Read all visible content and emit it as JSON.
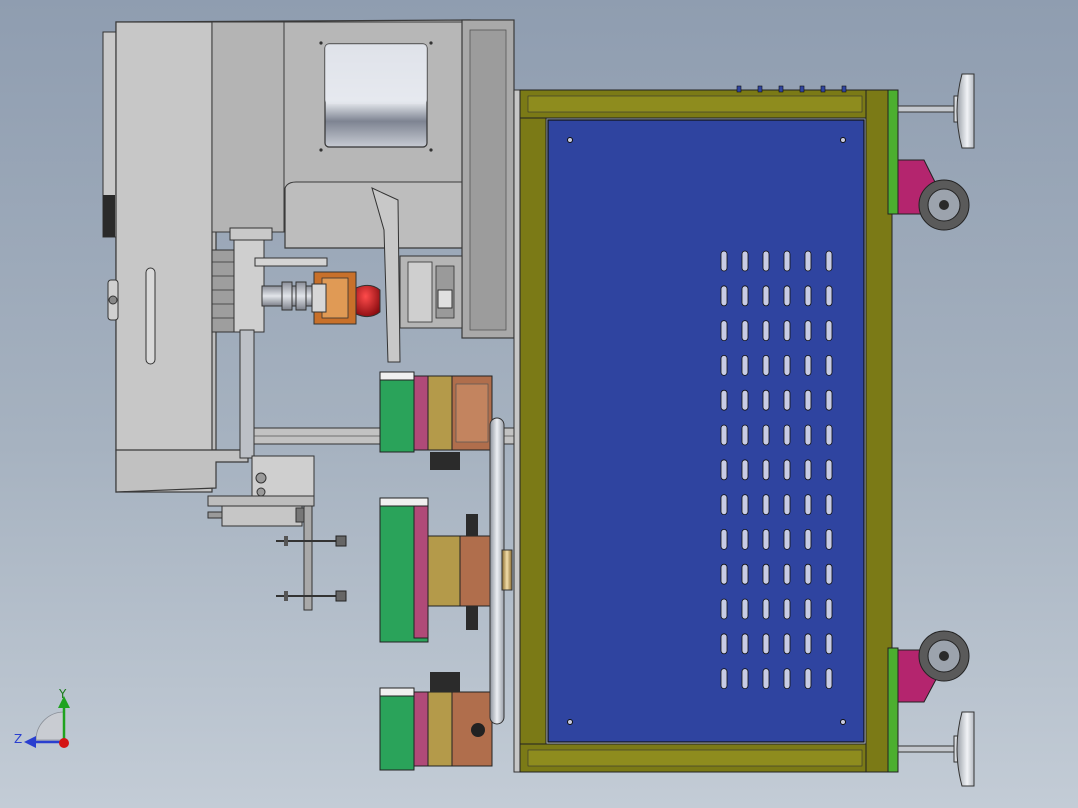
{
  "viewport": {
    "background_top": "#8f9db0",
    "background_bottom": "#c3ccd6"
  },
  "triad": {
    "y_label": "Y",
    "z_label": "Z",
    "y_color": "#1fa31f",
    "z_color": "#2a3fcf",
    "x_color": "#d41414"
  },
  "colors": {
    "machine_gray": "#b9b9b9",
    "frame_olive": "#7b7a16",
    "frame_green": "#4caf2f",
    "panel_blue": "#2f44a0",
    "caster_pink": "#b4256e",
    "block_green": "#2aa35a",
    "block_brown": "#b06e4c",
    "block_magenta": "#b04a78",
    "block_olive": "#b49a4a",
    "nozzle_red": "#b8141b",
    "mount_orange": "#c8702a"
  },
  "vent_grid": {
    "rows": 13,
    "cols": 6
  }
}
